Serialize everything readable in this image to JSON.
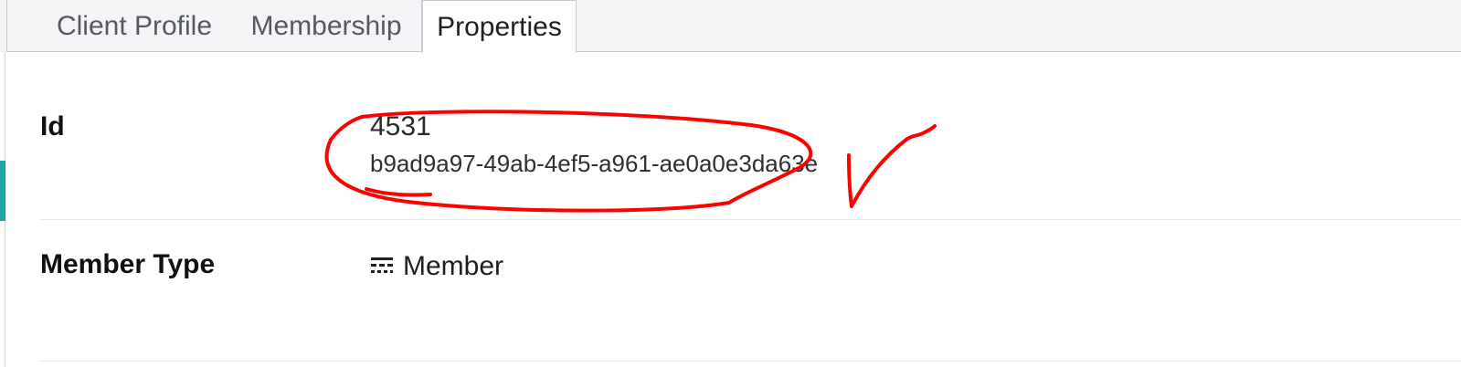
{
  "tabs": [
    {
      "label": "Client Profile",
      "selected": false
    },
    {
      "label": "Membership",
      "selected": false
    },
    {
      "label": "Properties",
      "selected": true
    }
  ],
  "properties": {
    "id": {
      "label": "Id",
      "value": "4531",
      "guid": "b9ad9a97-49ab-4ef5-a961-ae0a0e3da63e"
    },
    "member_type": {
      "label": "Member Type",
      "icon": "grid-member-icon",
      "value": "Member"
    }
  },
  "colors": {
    "accent_teal": "#1aa7a3",
    "annotation_red": "#ff0000",
    "border": "#c9c9cf",
    "tab_inactive_text": "#555a61"
  }
}
